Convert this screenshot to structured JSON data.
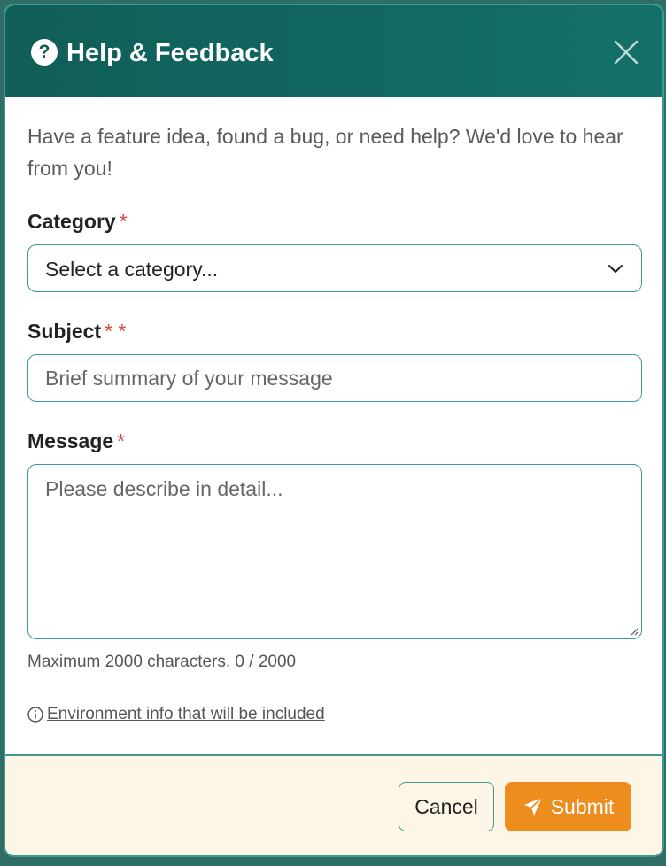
{
  "modal": {
    "title": "Help & Feedback",
    "help_icon_glyph": "?",
    "intro_text": "Have a feature idea, found a bug, or need help? We'd love to hear from you!"
  },
  "form": {
    "category": {
      "label": "Category",
      "required_marker": "*",
      "selected_value": "Select a category..."
    },
    "subject": {
      "label": "Subject",
      "required_marker": "* *",
      "placeholder": "Brief summary of your message",
      "value": ""
    },
    "message": {
      "label": "Message",
      "required_marker": "*",
      "placeholder": "Please describe in detail...",
      "value": "",
      "char_hint": "Maximum 2000 characters. 0 / 2000"
    },
    "environment_link": "Environment info that will be included"
  },
  "footer": {
    "cancel_label": "Cancel",
    "submit_label": "Submit"
  },
  "colors": {
    "header_bg": "#0f5e57",
    "accent_border": "#3e9a8e",
    "submit_bg": "#ec8d1e",
    "footer_bg": "#fdf6e6",
    "required": "#d64545"
  },
  "icons": {
    "help": "question-circle-icon",
    "close": "close-icon",
    "chevron": "chevron-down-icon",
    "info": "info-circle-icon",
    "submit": "paper-plane-icon"
  }
}
